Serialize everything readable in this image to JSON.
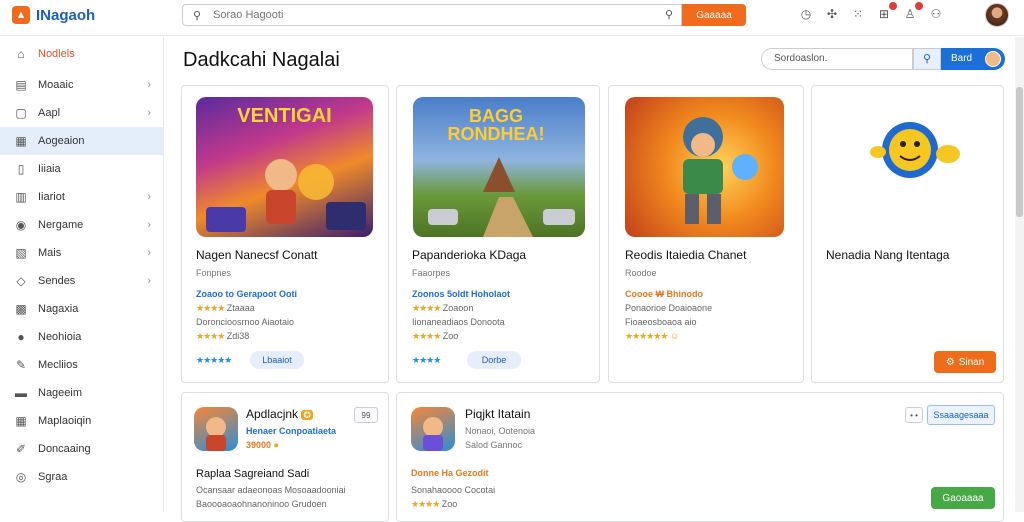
{
  "app": {
    "logo_text": "INagaoh"
  },
  "topbar": {
    "search_placeholder": "Sorao Hagooti",
    "search_button": "Gaaaaa",
    "icons": [
      "timer-icon",
      "puzzle-icon",
      "grid-dots-icon",
      "cart-icon",
      "user-icon",
      "account-icon"
    ]
  },
  "sidebar": {
    "items": [
      {
        "label": "Nodlels",
        "icon": "⌂",
        "chev": false
      },
      {
        "label": "Moaaic",
        "icon": "▤",
        "chev": true
      },
      {
        "label": "Aapl",
        "icon": "▢",
        "chev": true
      },
      {
        "label": "Aogeaion",
        "icon": "▦",
        "chev": false
      },
      {
        "label": "Iiiaia",
        "icon": "▯",
        "chev": false
      },
      {
        "label": "Iiariot",
        "icon": "▥",
        "chev": true
      },
      {
        "label": "Nergame",
        "icon": "◉",
        "chev": true
      },
      {
        "label": "Mais",
        "icon": "▧",
        "chev": true
      },
      {
        "label": "Sendes",
        "icon": "◇",
        "chev": true
      },
      {
        "label": "Nagaxia",
        "icon": "▩",
        "chev": false
      },
      {
        "label": "Neohioia",
        "icon": "●",
        "chev": false
      },
      {
        "label": "Mecliios",
        "icon": "✎",
        "chev": false
      },
      {
        "label": "Nageeim",
        "icon": "▬",
        "chev": false
      },
      {
        "label": "Maplaoiqin",
        "icon": "▦",
        "chev": false
      },
      {
        "label": "Doncaaing",
        "icon": "✐",
        "chev": false
      },
      {
        "label": "Sgraa",
        "icon": "◎",
        "chev": false
      }
    ]
  },
  "main": {
    "title": "Dadkcahi Nagalai",
    "search_placeholder": "Sordoaslon.",
    "filter_label": "Bard"
  },
  "cards": [
    {
      "thumb_text": "VENTIGAI",
      "title": "Nagen Nanecsf Conatt",
      "sub": "Fonpnes",
      "price": "Zoaoo to Gerapoot Ooti",
      "rating1": "Ztaaaa",
      "rating2": "Doroncioosrnoo Aiaotaio",
      "rating3": "Zdi38",
      "action": "Lbaaiot"
    },
    {
      "thumb_text": "BAGG RONDHEA!",
      "title": "Papanderioka KDaga",
      "sub": "Faaorpes",
      "price": "Zoonos 5oldt Hoholaot",
      "rating1": "Zoaoon",
      "rating2": "Iionaneadiaos Donoota",
      "rating3": "Zoo",
      "action": "Dorbe"
    },
    {
      "thumb_text": "",
      "title": "Reodis Itaiedia Chanet",
      "sub": "Roodoe",
      "price": "Coooe ₩ Bhinodo",
      "rating2": "Ponaorioe Doaioaone",
      "rating3": "Fioaeosboaoa aio"
    },
    {
      "thumb_text": "",
      "title": "Nenadia Nang Itentaga",
      "sub": "",
      "price": "",
      "action": "Sinan"
    }
  ],
  "cards_row2": [
    {
      "title": "Apdlacjnk",
      "sub": "Henaer Conpoatiaeta",
      "price": "39000",
      "section_title": "Raplaa Sagreiand Sadi",
      "desc1": "Ocansaar adaeonoas Mosoaadooniai",
      "desc2": "Baoooaoaohnanoninoo Grudoen",
      "mini": "99"
    },
    {
      "title": "Piqjkt Itatain",
      "sub": "Nonaoi, Ootenoia",
      "price": "Salod Gannoc",
      "section_title": "Donne Ha Gezodit",
      "desc1": "Sonahaoooo Cocotai",
      "desc2": "Zoo",
      "button": "Ssaaagesaaa",
      "green_button": "Gaoaaaa",
      "mini": "• •"
    }
  ],
  "colors": {
    "accent_orange": "#f26a1b",
    "accent_blue": "#1c6fd6",
    "green": "#47a846"
  }
}
